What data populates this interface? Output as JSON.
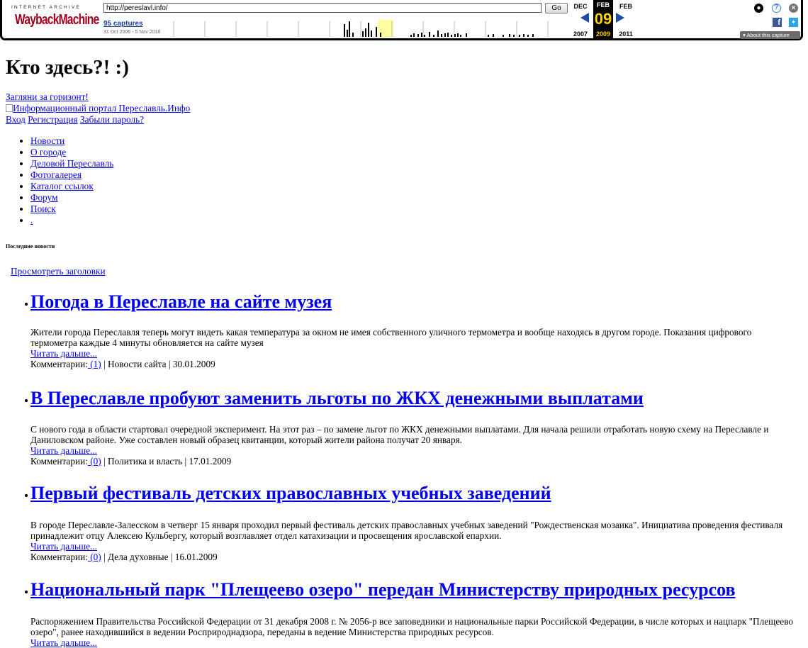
{
  "wayback": {
    "ia_label": "INTERNET ARCHIVE",
    "logo_word": "WaybackMachine",
    "url": "http://pereslavl.info/",
    "go_label": "Go",
    "captures_label": "95 captures",
    "range_label": "31 Oct 2006 - 5 Nov 2018",
    "prev_month": "DEC",
    "current_month": "FEB",
    "next_month": "FEB",
    "day": "09",
    "prev_year": "2007",
    "current_year": "2009",
    "next_year": "2011",
    "about_label": "About this capture",
    "highlight_color": "#ffffa0",
    "icons": [
      "user-icon",
      "help-icon",
      "close-icon",
      "facebook-icon",
      "twitter-icon"
    ]
  },
  "page": {
    "title": "Кто здесь?! :)",
    "horizon_link": "Загляни за горизонт!",
    "logo_alt": "Информационный портал Переславль.Инфо",
    "login": "Вход",
    "register": "Регистрация",
    "forgot": "Забыли пароль?",
    "nav": [
      "Новости",
      "О городе",
      "Деловой Переславль",
      "Фотогалерея",
      "Каталог ссылок",
      "Форум",
      "Поиск",
      "."
    ],
    "latest_heading": "Последние новости",
    "view_headlines": "Просмотреть заголовки",
    "read_more": "Читать дальше...",
    "comments_label": "Комментарии:",
    "news": [
      {
        "title": "Погода в Переславле на сайте музея",
        "text": "Жители города Переславля теперь могут видеть какая температура за окном не имея собственного уличного термометра и вообще находясь в другом городе. Показания цифрового термометра каждые 4 минуты обновляется на сайте музея",
        "comments": " (1)",
        "meta": " | Новости сайта | 30.01.2009"
      },
      {
        "title": "В Переславле пробуют заменить льготы по ЖКХ денежными выплатами",
        "text": "С нового года в области стартовал очередной эксперимент. На этот раз – по замене льгот по ЖКХ денежными выплатами. Для начала решили отработать новую схему на Переславле и Даниловском районе. Уже составлен новый образец квитанции, который жители района получат 20 января.",
        "comments": " (0)",
        "meta": " | Политика и власть | 17.01.2009"
      },
      {
        "title": "Первый фестиваль детских православных учебных заведений",
        "text": "В городе Переславле-Залесском в четверг 15 января проходил первый фестиваль детских православных учебных заведений \"Рождественская мозаика\". Инициатива проведения фестиваля принадлежит отцу Алексею Кульбергу, который возглавляет отдел катахизации и просвещения ярославской епархии.",
        "comments": " (0)",
        "meta": " | Дела духовные | 16.01.2009"
      },
      {
        "title": "Национальный парк \"Плещеево озеро\" передан Министерству природных ресурсов",
        "text": "Распоряжением Правительства Российской Федерации от 31 декабря 2008 г. № 2056-р все заповедники и национальные парки Российской Федерации, в числе которых и нацпарк \"Плещеево озеро\", ранее находившийся в ведении Росприроднадзора, переданы в ведение Министерства природных ресурсов."
      }
    ]
  }
}
